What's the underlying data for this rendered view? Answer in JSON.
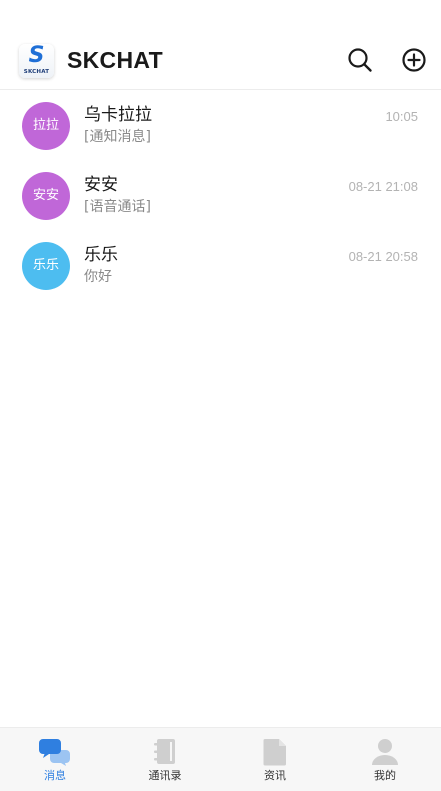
{
  "header": {
    "logo_letter": "S",
    "logo_text": "SKCHAT",
    "title": "SKCHAT",
    "search_icon": "search-icon",
    "add_icon": "plus-circle-icon"
  },
  "conversations": [
    {
      "avatar_text": "拉拉",
      "avatar_color": "#c067d8",
      "name": "乌卡拉拉",
      "preview": "[通知消息]",
      "time": "10:05"
    },
    {
      "avatar_text": "安安",
      "avatar_color": "#c067d8",
      "name": "安安",
      "preview": "[语音通话]",
      "time": "08-21 21:08"
    },
    {
      "avatar_text": "乐乐",
      "avatar_color": "#4dbdf0",
      "name": "乐乐",
      "preview": "你好",
      "time": "08-21 20:58"
    }
  ],
  "tabbar": {
    "active_color": "#2f7fe0",
    "inactive_icon_color": "#cfcfcf",
    "tabs": [
      {
        "label": "消息",
        "icon": "chat-bubbles-icon",
        "active": true
      },
      {
        "label": "通讯录",
        "icon": "contacts-book-icon",
        "active": false
      },
      {
        "label": "资讯",
        "icon": "document-icon",
        "active": false
      },
      {
        "label": "我的",
        "icon": "person-icon",
        "active": false
      }
    ]
  }
}
